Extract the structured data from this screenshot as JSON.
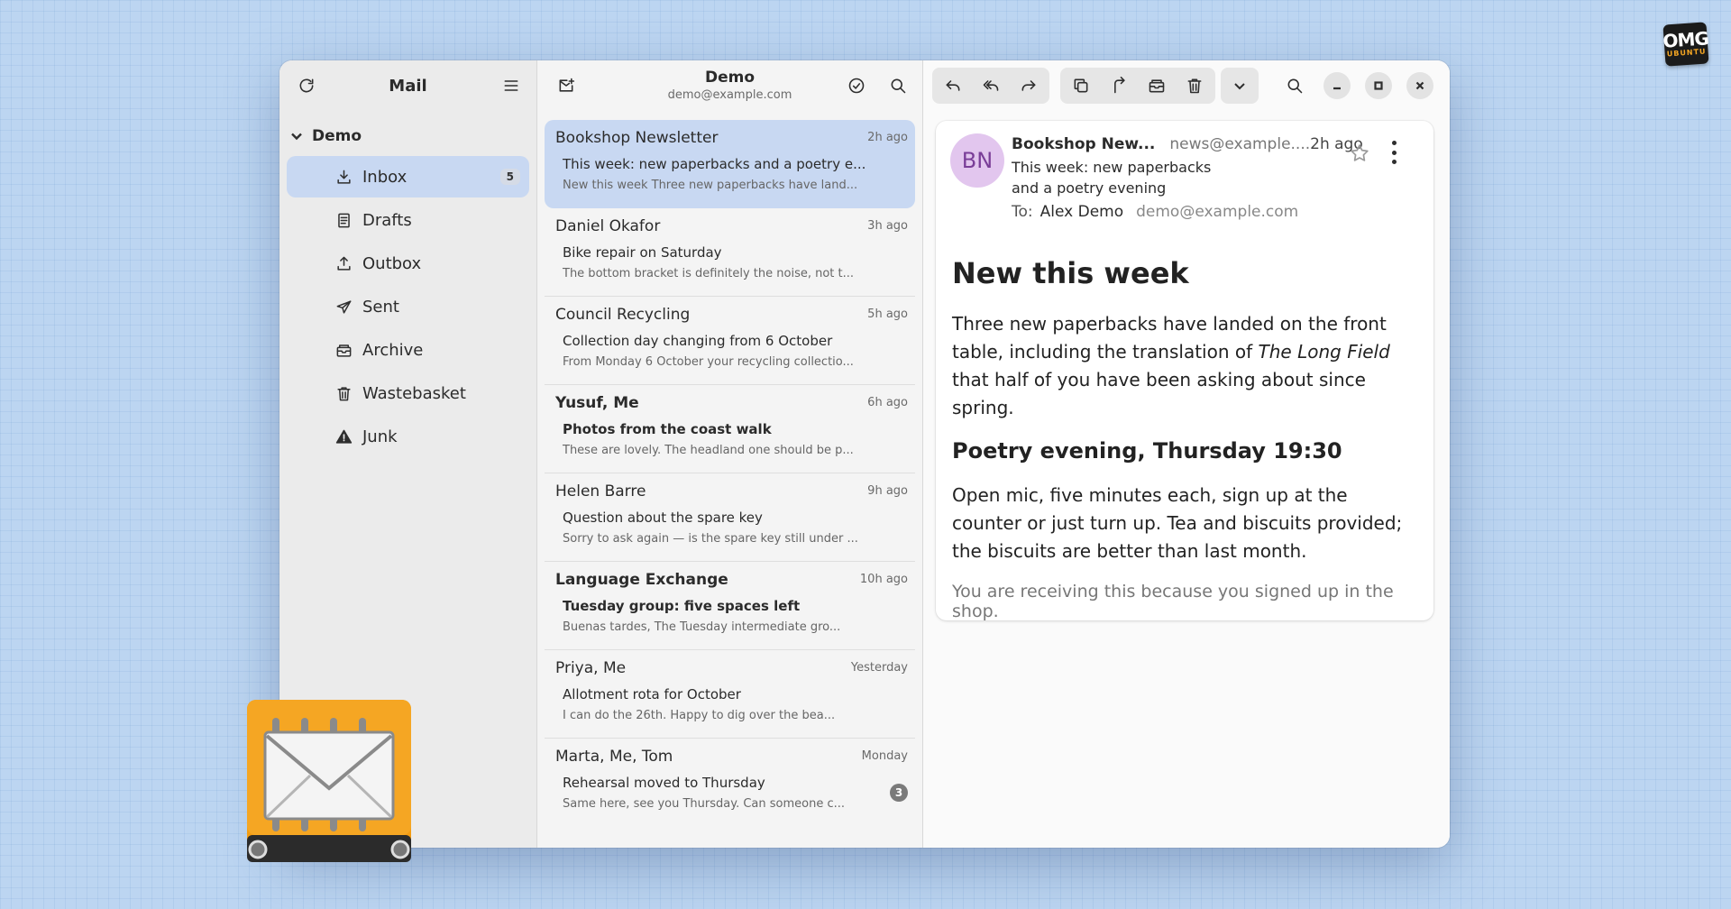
{
  "brand": {
    "line1": "OMG",
    "line2": "UBUNTU"
  },
  "sidebar": {
    "title": "Mail",
    "account": "Demo",
    "folders": [
      {
        "label": "Inbox",
        "icon": "inbox-icon",
        "count": "5"
      },
      {
        "label": "Drafts",
        "icon": "drafts-icon"
      },
      {
        "label": "Outbox",
        "icon": "outbox-icon"
      },
      {
        "label": "Sent",
        "icon": "sent-icon"
      },
      {
        "label": "Archive",
        "icon": "archive-icon"
      },
      {
        "label": "Wastebasket",
        "icon": "trash-icon"
      },
      {
        "label": "Junk",
        "icon": "junk-icon"
      }
    ]
  },
  "list": {
    "title": "Demo",
    "subtitle": "demo@example.com",
    "messages": [
      {
        "from": "Bookshop Newsletter",
        "time": "2h ago",
        "subject": "This week: new paperbacks and a poetry e...",
        "preview": "New this week Three new paperbacks have land..."
      },
      {
        "from": "Daniel Okafor",
        "time": "3h ago",
        "subject": "Bike repair on Saturday",
        "preview": "The bottom bracket is definitely the noise, not t..."
      },
      {
        "from": "Council Recycling",
        "time": "5h ago",
        "subject": "Collection day changing from 6 October",
        "preview": "From Monday 6 October your recycling collectio..."
      },
      {
        "from": "Yusuf, Me",
        "time": "6h ago",
        "subject": "Photos from the coast walk",
        "preview": "These are lovely. The headland one should be p..."
      },
      {
        "from": "Helen Barre",
        "time": "9h ago",
        "subject": "Question about the spare key",
        "preview": "Sorry to ask again — is the spare key still under ..."
      },
      {
        "from": "Language Exchange",
        "time": "10h ago",
        "subject": "Tuesday group: five spaces left",
        "preview": "Buenas tardes, The Tuesday intermediate gro..."
      },
      {
        "from": "Priya, Me",
        "time": "Yesterday",
        "subject": "Allotment rota for October",
        "preview": "I can do the 26th. Happy to dig over the bea..."
      },
      {
        "from": "Marta, Me, Tom",
        "time": "Monday",
        "subject": "Rehearsal moved to Thursday",
        "preview": "Same here, see you Thursday. Can someone c...",
        "thread_count": "3"
      }
    ]
  },
  "reader": {
    "avatar_initials": "BN",
    "sender": "Bookshop New...",
    "sender_addr": "news@example....",
    "time": "2h ago",
    "subject": "This week: new paperbacks and a poetry evening",
    "to_label": "To:",
    "to_name": "Alex Demo",
    "to_addr": "demo@example.com",
    "heading": "New this week",
    "para1_a": "Three new paperbacks have landed on the front table, including the translation of ",
    "para1_em": "The Long Field",
    "para1_b": " that half of you have been asking about since spring.",
    "heading2": "Poetry evening, Thursday 19:30",
    "para2": "Open mic, five minutes each, sign up at the counter or just turn up. Tea and biscuits provided; the biscuits are better than last month.",
    "footer": "You are receiving this because you signed up in the shop."
  },
  "colors": {
    "accent_selection": "#c8d8f2",
    "avatar_bg": "#e2c6ee",
    "avatar_fg": "#7a3e98",
    "desktop": "#bcd5f1"
  }
}
